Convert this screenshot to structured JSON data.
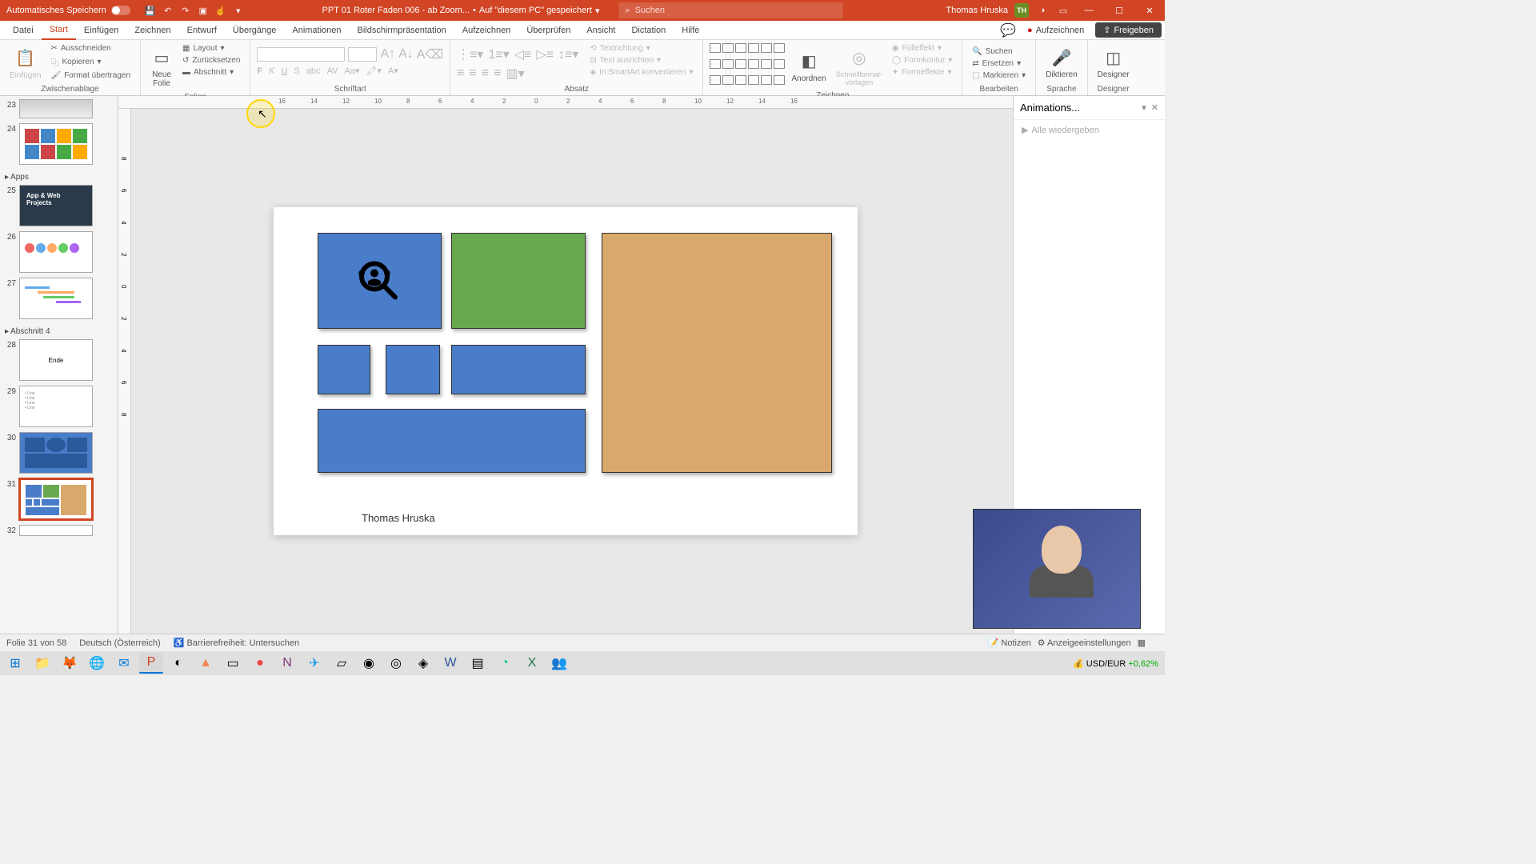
{
  "titlebar": {
    "autosave": "Automatisches Speichern",
    "filename": "PPT 01 Roter Faden 006 - ab Zoom...",
    "saved": "Auf \"diesem PC\" gespeichert",
    "search_placeholder": "Suchen",
    "username": "Thomas Hruska",
    "user_initials": "TH"
  },
  "menu": {
    "datei": "Datei",
    "start": "Start",
    "einfuegen": "Einfügen",
    "zeichnen": "Zeichnen",
    "entwurf": "Entwurf",
    "uebergaenge": "Übergänge",
    "animationen": "Animationen",
    "bildschirm": "Bildschirmpräsentation",
    "aufzeichnen": "Aufzeichnen",
    "ueberpruefen": "Überprüfen",
    "ansicht": "Ansicht",
    "dictation": "Dictation",
    "hilfe": "Hilfe",
    "rec": "Aufzeichnen",
    "share": "Freigeben"
  },
  "ribbon": {
    "einfuegen": "Einfügen",
    "ausschneiden": "Ausschneiden",
    "kopieren": "Kopieren",
    "format": "Format übertragen",
    "clipboard": "Zwischenablage",
    "neue_folie": "Neue\nFolie",
    "layout": "Layout",
    "zuruecksetzen": "Zurücksetzen",
    "abschnitt": "Abschnitt",
    "folien": "Folien",
    "schriftart": "Schriftart",
    "absatz": "Absatz",
    "textrichtung": "Textrichtung",
    "text_ausrichten": "Text ausrichten",
    "smartart": "In SmartArt konvertieren",
    "anordnen": "Anordnen",
    "schnellformat": "Schnellformat-\nvorlagen",
    "fuelleffekt": "Fülleffekt",
    "formkontur": "Formkontur",
    "formeffekte": "Formeffekte",
    "zeichnen": "Zeichnen",
    "suchen": "Suchen",
    "ersetzen": "Ersetzen",
    "markieren": "Markieren",
    "bearbeiten": "Bearbeiten",
    "diktieren": "Diktieren",
    "sprache": "Sprache",
    "designer": "Designer",
    "designer_grp": "Designer"
  },
  "thumbs": {
    "apps": "Apps",
    "abschnitt4": "Abschnitt 4",
    "n23": "23",
    "n24": "24",
    "n25": "25",
    "n26": "26",
    "n27": "27",
    "n28": "28",
    "n29": "29",
    "n30": "30",
    "n31": "31",
    "n32": "32",
    "t25_title": "App & Web\nProjects",
    "t28_title": "Ende"
  },
  "slide": {
    "author": "Thomas Hruska"
  },
  "anim": {
    "title": "Animations...",
    "play": "Alle wiedergeben"
  },
  "status": {
    "slide": "Folie 31 von 58",
    "lang": "Deutsch (Österreich)",
    "access": "Barrierefreiheit: Untersuchen",
    "notizen": "Notizen",
    "anzeige": "Anzeigeeinstellungen"
  },
  "taskbar": {
    "currency": "USD/EUR",
    "rate": "+0,62%"
  }
}
